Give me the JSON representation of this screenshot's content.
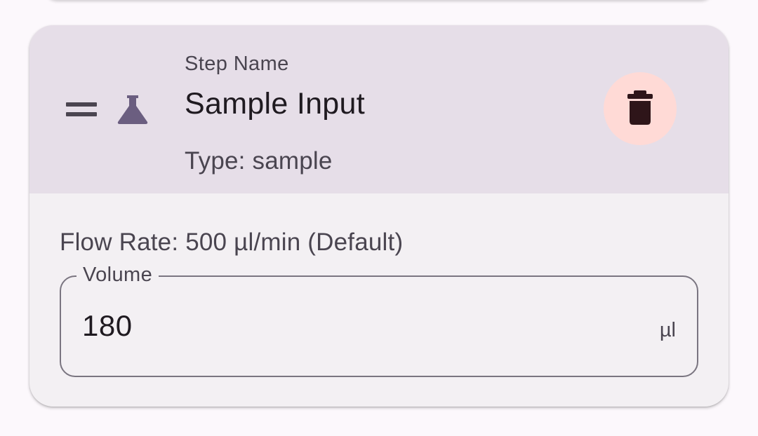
{
  "step": {
    "label": "Step Name",
    "name": "Sample Input",
    "type_text": "Type: sample",
    "icon": "flask-icon",
    "drag_icon": "drag-handle-icon",
    "delete_icon": "trash-icon"
  },
  "details": {
    "flow_rate_text": "Flow Rate: 500 µl/min (Default)",
    "volume": {
      "label": "Volume",
      "value": "180",
      "suffix": "µl"
    }
  },
  "colors": {
    "header_bg": "#e6dee8",
    "card_bg": "#f3f0f3",
    "delete_bg": "#ffdad6",
    "icon_accent": "#6b5e80",
    "delete_icon": "#2e1519"
  }
}
